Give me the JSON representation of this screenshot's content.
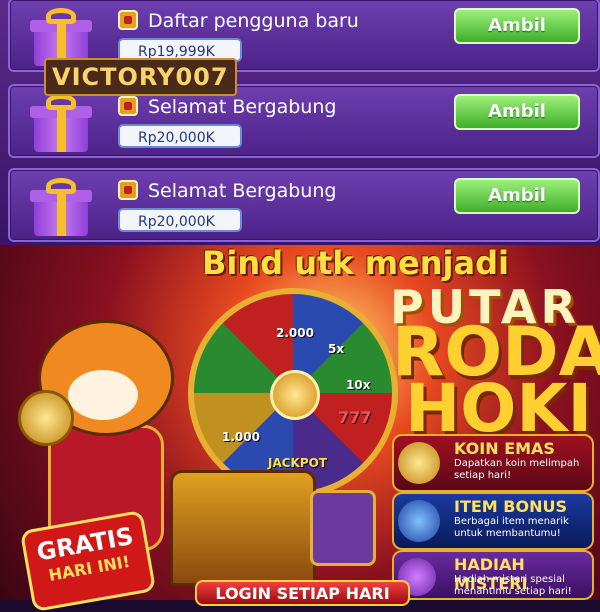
{
  "rewards": [
    {
      "title": "Daftar pengguna baru",
      "amount": "Rp19,999K",
      "button": "Ambil"
    },
    {
      "title": "Selamat Bergabung",
      "amount": "Rp20,000K",
      "button": "Ambil"
    },
    {
      "title": "Selamat Bergabung",
      "amount": "Rp20,000K",
      "button": "Ambil"
    }
  ],
  "user_badge": "VICTORY007",
  "promo": {
    "headline": "Bind utk menjadi",
    "title_1": "PUTAR",
    "title_2": "RODA",
    "title_3": "HOKI",
    "wheel_labels": [
      "2.000",
      "5x",
      "10x",
      "777",
      "1.000"
    ],
    "jackpot": "JACKPOT",
    "gratis_1": "GRATIS",
    "gratis_2": "HARI INI!",
    "login": "LOGIN SETIAP HARI",
    "features": [
      {
        "title": "KOIN EMAS",
        "desc": "Dapatkan koin melimpah setiap hari!"
      },
      {
        "title": "ITEM BONUS",
        "desc": "Berbagai item menarik untuk membantumu!"
      },
      {
        "title": "HADIAH MISTERI",
        "desc": "Hadiah misteri spesial menantimu setiap hari!"
      }
    ]
  }
}
